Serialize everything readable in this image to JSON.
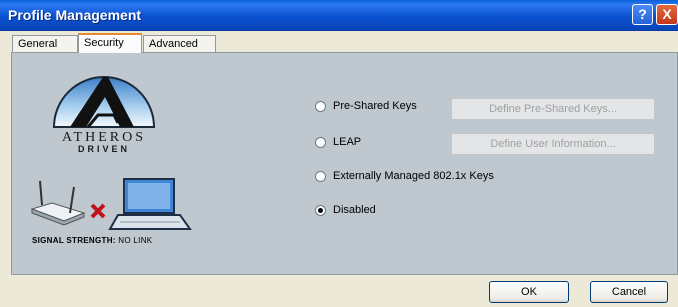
{
  "window": {
    "title": "Profile Management",
    "help_symbol": "?",
    "close_symbol": "X"
  },
  "tabs": [
    {
      "label": "General"
    },
    {
      "label": "Security",
      "active": true
    },
    {
      "label": "Advanced"
    }
  ],
  "branding": {
    "line1": "ATHEROS",
    "line2": "DRIVEN"
  },
  "status": {
    "signal_label": "SIGNAL STRENGTH:",
    "signal_value": "NO LINK"
  },
  "security": {
    "options": [
      {
        "label": "Pre-Shared Keys",
        "checked": false
      },
      {
        "label": "LEAP",
        "checked": false
      },
      {
        "label": "Externally Managed 802.1x Keys",
        "checked": false
      },
      {
        "label": "Disabled",
        "checked": true
      }
    ],
    "define_psk_label": "Define Pre-Shared Keys...",
    "define_user_label": "Define User Information..."
  },
  "buttons": {
    "ok": "OK",
    "cancel": "Cancel"
  },
  "colors": {
    "titlebar": "#0b52d0",
    "panel": "#bfc7cf",
    "dialog": "#ece9d8",
    "tab_highlight": "#e68b2c"
  },
  "icons": [
    "help-icon",
    "close-icon",
    "atheros-logo",
    "router-icon",
    "disconnect-x-icon",
    "laptop-icon"
  ]
}
